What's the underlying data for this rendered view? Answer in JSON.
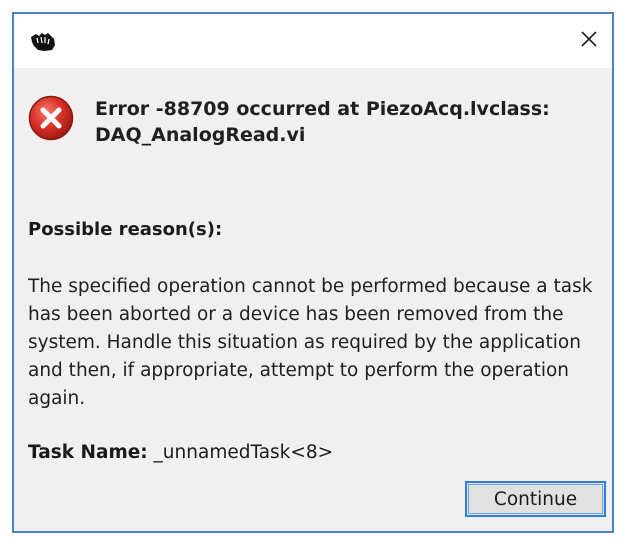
{
  "dialog": {
    "app_icon": "labview-hand-icon",
    "close_icon": "close-icon",
    "error_icon": "error-icon",
    "error_title": "Error -88709 occurred at PiezoAcq.lvclass: DAQ_AnalogRead.vi",
    "reason_heading": "Possible reason(s):",
    "reason_text": "The specified operation cannot be performed because a task has been aborted or a device has been removed from the system. Handle this situation as required by the application and then, if appropriate, attempt to perform the operation again.",
    "task_label": "Task Name:",
    "task_value": " _unnamedTask<8>",
    "continue_label": "Continue"
  },
  "colors": {
    "accent_border": "#4a82c8",
    "button_focus": "#2f7fd6",
    "error_red": "#d9322a",
    "dialog_bg": "#f0f0f0"
  }
}
